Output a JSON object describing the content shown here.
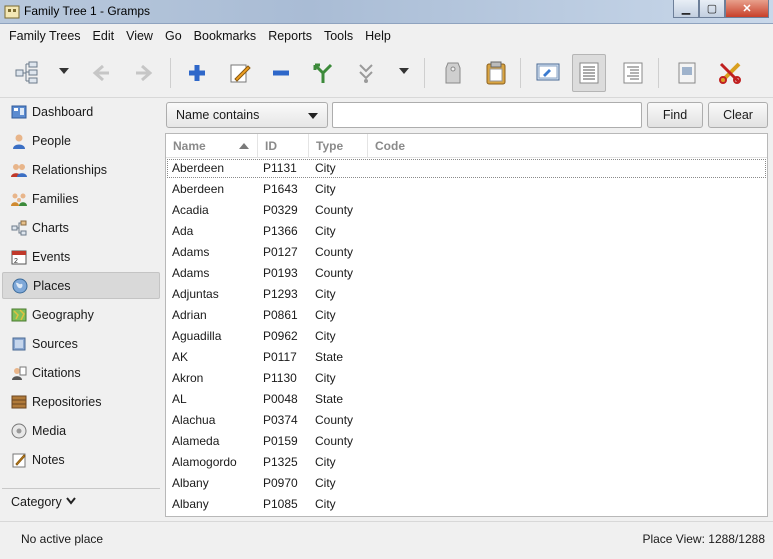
{
  "window": {
    "title": "Family Tree 1 - Gramps",
    "buttons": [
      "▁",
      "▢",
      "✕"
    ]
  },
  "menu": [
    "Family Trees",
    "Edit",
    "View",
    "Go",
    "Bookmarks",
    "Reports",
    "Tools",
    "Help"
  ],
  "toolbar": {
    "icons": [
      "tree-icon",
      "back-arrow-icon",
      "forward-arrow-icon",
      "add-icon",
      "edit-icon",
      "remove-icon",
      "merge-icon",
      "filter-down-icon",
      "tag-icon",
      "clipboard-icon",
      "configure-view-icon",
      "list-view-icon",
      "tree-view-icon",
      "media-icon",
      "tools-icon"
    ]
  },
  "sidebar": {
    "items": [
      {
        "label": "Dashboard",
        "icon": "dashboard-icon"
      },
      {
        "label": "People",
        "icon": "person-icon"
      },
      {
        "label": "Relationships",
        "icon": "relationships-icon"
      },
      {
        "label": "Families",
        "icon": "families-icon"
      },
      {
        "label": "Charts",
        "icon": "charts-icon"
      },
      {
        "label": "Events",
        "icon": "events-icon"
      },
      {
        "label": "Places",
        "icon": "globe-icon"
      },
      {
        "label": "Geography",
        "icon": "map-icon"
      },
      {
        "label": "Sources",
        "icon": "book-icon"
      },
      {
        "label": "Citations",
        "icon": "citation-icon"
      },
      {
        "label": "Repositories",
        "icon": "repository-icon"
      },
      {
        "label": "Media",
        "icon": "media-icon"
      },
      {
        "label": "Notes",
        "icon": "notes-icon"
      }
    ],
    "selected": "Places",
    "category_label": "Category"
  },
  "filter": {
    "select_value": "Name contains",
    "input_value": "",
    "find_label": "Find",
    "clear_label": "Clear"
  },
  "table": {
    "columns": [
      "Name",
      "ID",
      "Type",
      "Code"
    ],
    "rows": [
      [
        "Aberdeen",
        "P1131",
        "City"
      ],
      [
        "Aberdeen",
        "P1643",
        "City"
      ],
      [
        "Acadia",
        "P0329",
        "County"
      ],
      [
        "Ada",
        "P1366",
        "City"
      ],
      [
        "Adams",
        "P0127",
        "County"
      ],
      [
        "Adams",
        "P0193",
        "County"
      ],
      [
        "Adjuntas",
        "P1293",
        "City"
      ],
      [
        "Adrian",
        "P0861",
        "City"
      ],
      [
        "Aguadilla",
        "P0962",
        "City"
      ],
      [
        "AK",
        "P0117",
        "State"
      ],
      [
        "Akron",
        "P1130",
        "City"
      ],
      [
        "AL",
        "P0048",
        "State"
      ],
      [
        "Alachua",
        "P0374",
        "County"
      ],
      [
        "Alameda",
        "P0159",
        "County"
      ],
      [
        "Alamogordo",
        "P1325",
        "City"
      ],
      [
        "Albany",
        "P0970",
        "City"
      ],
      [
        "Albany",
        "P1085",
        "City"
      ]
    ]
  },
  "status": {
    "left": "No active place",
    "right": "Place View: 1288/1288"
  }
}
